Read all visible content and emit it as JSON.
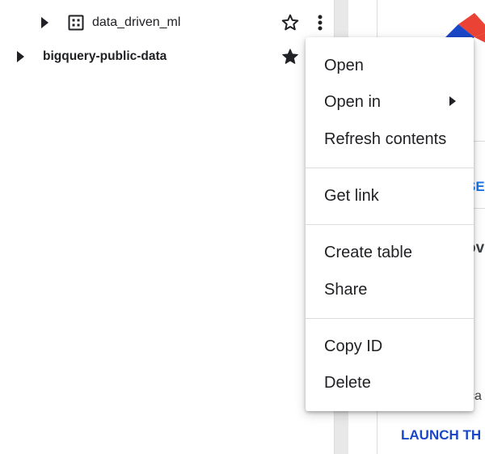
{
  "explorer": {
    "rows": [
      {
        "label": "data_driven_ml",
        "starred": false
      },
      {
        "label": "bigquery-public-data",
        "starred": true
      }
    ]
  },
  "context_menu": {
    "items": [
      {
        "label": "Open"
      },
      {
        "label": "Open in",
        "has_submenu": true
      },
      {
        "label": "Refresh contents"
      },
      {
        "label": "Get link"
      },
      {
        "label": "Create table"
      },
      {
        "label": "Share"
      },
      {
        "label": "Copy ID"
      },
      {
        "label": "Delete"
      }
    ]
  },
  "content": {
    "link_fragment": "SE",
    "heading_fragment": "ov",
    "body_fragment": "ca",
    "launch_fragment": "LAUNCH TH"
  },
  "colors": {
    "link": "#1a73e8",
    "launch": "#1a47c8",
    "logo_red": "#ea4335",
    "logo_blue": "#1a47c8"
  },
  "icons": {
    "expand": "caret-right-icon",
    "dataset": "dataset-grid-icon",
    "star_empty": "star-outline-icon",
    "star_filled": "star-filled-icon",
    "more": "more-vert-icon",
    "submenu": "caret-right-icon"
  }
}
